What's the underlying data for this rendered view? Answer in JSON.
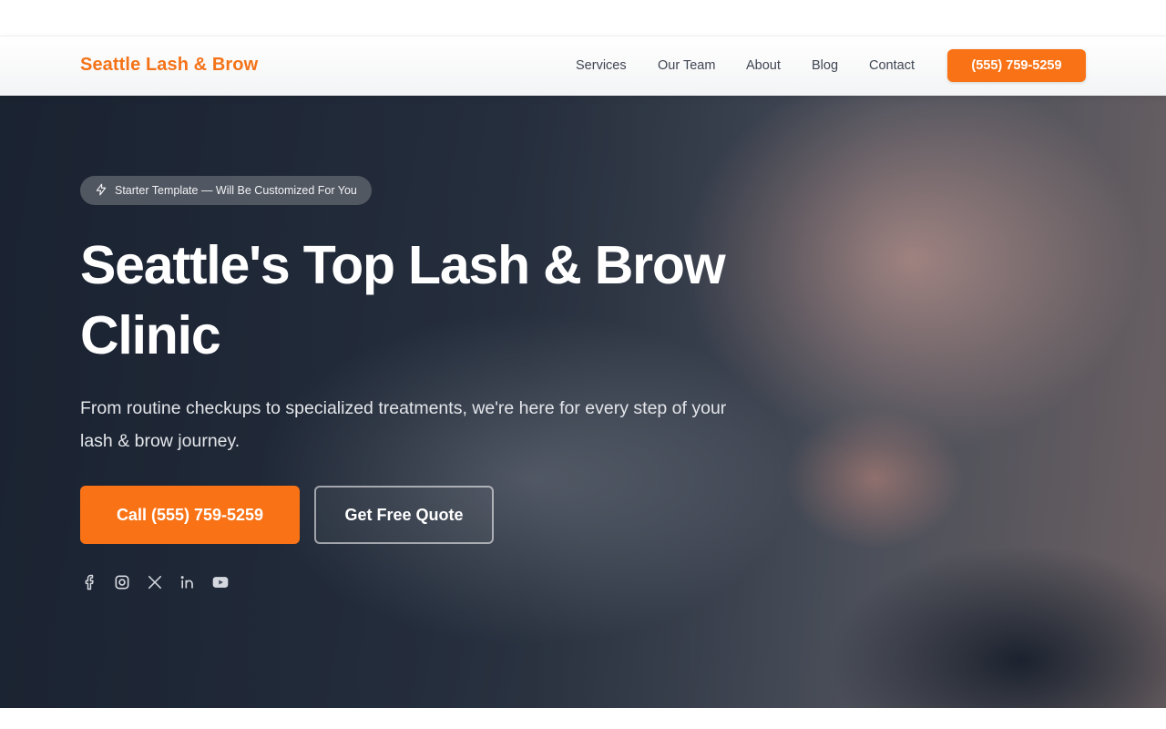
{
  "header": {
    "brand": "Seattle Lash & Brow",
    "nav": [
      "Services",
      "Our Team",
      "About",
      "Blog",
      "Contact"
    ],
    "phone_button": "(555) 759-5259"
  },
  "hero": {
    "badge": "Starter Template — Will Be Customized For You",
    "badge_icon": "sparkle-icon",
    "title": "Seattle's Top Lash & Brow Clinic",
    "subtitle": "From routine checkups to specialized treatments, we're here for every step of your lash & brow journey.",
    "primary_button": "Call (555) 759-5259",
    "secondary_button": "Get Free Quote",
    "socials": [
      "facebook-icon",
      "instagram-icon",
      "x-icon",
      "linkedin-icon",
      "youtube-icon"
    ]
  },
  "colors": {
    "accent": "#f97316",
    "brand_text": "#f47318",
    "nav_text": "#3f4652"
  }
}
